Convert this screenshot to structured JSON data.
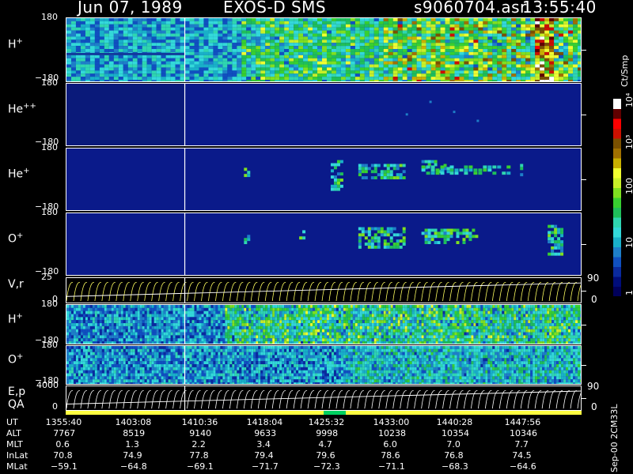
{
  "header": {
    "date": "Jun 07, 1989",
    "instrument": "EXOS-D SMS",
    "file": "s9060704.asr",
    "time": "13:55:40"
  },
  "panels": [
    {
      "name": "H+",
      "base": "H",
      "sup": "+",
      "ytop": "180",
      "ybot": "−180"
    },
    {
      "name": "He++",
      "base": "He",
      "sup": "++",
      "ytop": "180",
      "ybot": "−180"
    },
    {
      "name": "He+",
      "base": "He",
      "sup": "+",
      "ytop": "180",
      "ybot": "−180"
    },
    {
      "name": "O+",
      "base": "O",
      "sup": "+",
      "ytop": "180",
      "ybot": "−180"
    },
    {
      "name": "V,r",
      "base": "V,r",
      "sup": "",
      "ytop": "25",
      "ybot": "0",
      "right_top": "90",
      "right_bot": "0"
    },
    {
      "name": "H+ (low)",
      "base": "H",
      "sup": "+",
      "ytop": "180",
      "ybot": "−180"
    },
    {
      "name": "O+ (low)",
      "base": "O",
      "sup": "+",
      "ytop": "180",
      "ybot": "−180"
    },
    {
      "name": "E,p QA",
      "base": "E,p",
      "sup": "",
      "line2": "QA",
      "ytop": "4000",
      "ybot": "0",
      "right_top": "90",
      "right_bot": "0"
    }
  ],
  "colorbar": {
    "unit": "Ct/Smp",
    "labels": [
      {
        "text": "1",
        "frac": 0.03
      },
      {
        "text": "10",
        "frac": 0.27
      },
      {
        "text": "100",
        "frac": 0.54
      },
      {
        "text": "10³",
        "frac": 0.77
      },
      {
        "text": "10⁴",
        "frac": 0.98
      }
    ],
    "colors": [
      "#00005a",
      "#000d7a",
      "#0a2a9e",
      "#1050c0",
      "#1e7fc8",
      "#19b0c8",
      "#33d9d9",
      "#2fd6b0",
      "#1fbf5a",
      "#38d030",
      "#7fe020",
      "#c8f028",
      "#f0ff30",
      "#c8b000",
      "#a07000",
      "#7a5000",
      "#cc1000",
      "#ff0000",
      "#600000",
      "#ffffff"
    ]
  },
  "chart_data": {
    "type": "heatmap",
    "title": "Jun 07, 1989   EXOS-D SMS",
    "xlabel": "UT",
    "x_tick_labels": [
      "1355:40",
      "1403:08",
      "1410:36",
      "1418:04",
      "1425:32",
      "1433:00",
      "1440:28",
      "1447:56"
    ],
    "orbit_table": {
      "rows": [
        {
          "label": "UT",
          "values": [
            "1355:40",
            "1403:08",
            "1410:36",
            "1418:04",
            "1425:32",
            "1433:00",
            "1440:28",
            "1447:56"
          ]
        },
        {
          "label": "ALT",
          "values": [
            "7767",
            "8519",
            "9140",
            "9633",
            "9998",
            "10238",
            "10354",
            "10346"
          ]
        },
        {
          "label": "MLT",
          "values": [
            "0.6",
            "1.3",
            "2.2",
            "3.4",
            "4.7",
            "6.0",
            "7.0",
            "7.7"
          ]
        },
        {
          "label": "InLat",
          "values": [
            "70.8",
            "74.9",
            "77.8",
            "79.4",
            "79.6",
            "78.6",
            "76.8",
            "74.5"
          ]
        },
        {
          "label": "MLat",
          "values": [
            "−59.1",
            "−64.8",
            "−69.1",
            "−71.7",
            "−72.3",
            "−71.1",
            "−68.3",
            "−64.6"
          ]
        }
      ]
    },
    "y_ranges": [
      [
        -180,
        180
      ],
      [
        -180,
        180
      ],
      [
        -180,
        180
      ],
      [
        -180,
        180
      ],
      [
        0,
        25
      ],
      [
        -180,
        180
      ],
      [
        -180,
        180
      ],
      [
        0,
        4000
      ]
    ],
    "colorscale": "log counts 1 to 10^4 (Ct/Smp)"
  },
  "side_label": "Sep-00  2CM33L"
}
